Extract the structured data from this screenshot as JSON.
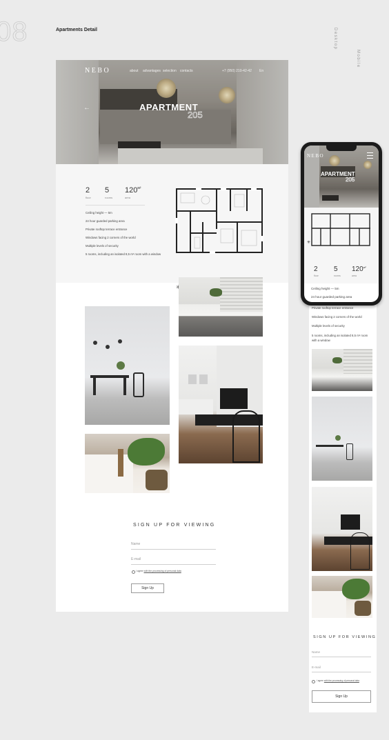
{
  "page": {
    "number": "08",
    "title": "Apartments Detail",
    "label_desktop": "Desktop",
    "label_mobile": "Mobile"
  },
  "nav": {
    "logo": "NEBO",
    "links": [
      "about",
      "advantages",
      "selection",
      "contacts"
    ],
    "phone": "+7 (950) 210-42-42",
    "lang": "En"
  },
  "hero": {
    "title": "APARTMENT",
    "number": "205",
    "arrow": "←"
  },
  "stats": [
    {
      "value": "2",
      "label": "floor"
    },
    {
      "value": "5",
      "label": "rooms"
    },
    {
      "value": "120",
      "unit": "м²",
      "label": "area"
    }
  ],
  "features": [
    "Ceiling height — 5m",
    "24 hour guarded parking area",
    "Private rooftop terrace entrance",
    "Windows facing 2 corners of the world",
    "Multiple levels of security",
    "5 rooms, including an isolated 8,5 m² room with a window"
  ],
  "signup": {
    "title": "SIGN UP FOR VIEWING",
    "name_placeholder": "Name",
    "email_placeholder": "E-mail",
    "consent_prefix": "I agree ",
    "consent_link": "with the processing of personal data",
    "button": "Sign Up"
  },
  "colors": {
    "background": "#ebebeb",
    "card": "#ffffff",
    "info_panel": "#f6f6f6",
    "text": "#222222"
  }
}
